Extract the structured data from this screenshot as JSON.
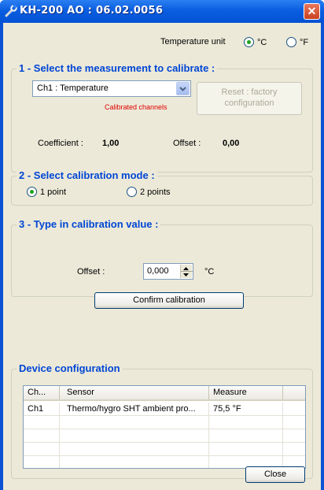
{
  "window": {
    "title": "KH-200 AO : 06.02.0056",
    "close_glyph": "✕"
  },
  "units": {
    "label": "Temperature unit",
    "options": [
      {
        "label": "°C",
        "selected": true
      },
      {
        "label": "°F",
        "selected": false
      }
    ]
  },
  "section1": {
    "title": "1 - Select the measurement to calibrate :",
    "channel_select": "Ch1 : Temperature",
    "calibrated_note": "Calibrated channels",
    "reset_button": "Reset : factory configuration",
    "coefficient_label": "Coefficient :",
    "coefficient_value": "1,00",
    "offset_label": "Offset :",
    "offset_value": "0,00"
  },
  "section2": {
    "title": "2 - Select calibration mode :",
    "modes": [
      {
        "label": "1 point",
        "selected": true
      },
      {
        "label": "2 points",
        "selected": false
      }
    ]
  },
  "section3": {
    "title": "3 - Type in calibration value :",
    "offset_label": "Offset :",
    "offset_value": "0,000",
    "unit": "°C",
    "confirm_button": "Confirm calibration"
  },
  "device_config": {
    "title": "Device configuration",
    "columns": [
      "Ch...",
      "Sensor",
      "Measure"
    ],
    "rows": [
      {
        "channel": "Ch1",
        "sensor": "Thermo/hygro SHT ambient pro...",
        "measure": "75,5 °F"
      }
    ]
  },
  "footer": {
    "close_button": "Close"
  },
  "colors": {
    "group_title": "#0046d5",
    "note_red": "#e00000",
    "titlebar": "#0a5ee0"
  }
}
